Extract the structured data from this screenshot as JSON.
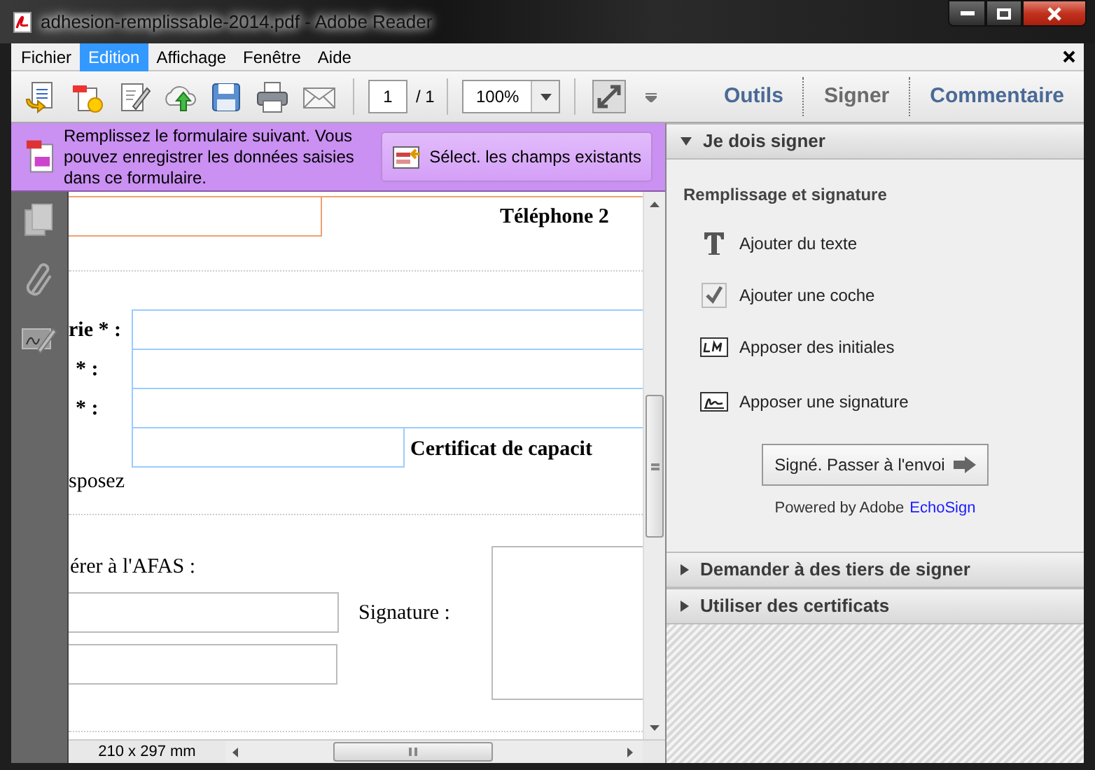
{
  "window": {
    "title": "adhesion-remplissable-2014.pdf - Adobe Reader"
  },
  "menu": [
    {
      "label": "Fichier",
      "selected": false
    },
    {
      "label": "Edition",
      "selected": true
    },
    {
      "label": "Affichage",
      "selected": false
    },
    {
      "label": "Fenêtre",
      "selected": false
    },
    {
      "label": "Aide",
      "selected": false
    }
  ],
  "toolbar": {
    "page": "1",
    "page_total": "/ 1",
    "zoom": "100%"
  },
  "panel_tabs": [
    {
      "label": "Outils",
      "selected": false
    },
    {
      "label": "Signer",
      "selected": true
    },
    {
      "label": "Commentaire",
      "selected": false
    }
  ],
  "form_bar": {
    "message": "Remplissez le formulaire suivant. Vous pouvez enregistrer les données saisies dans ce formulaire.",
    "button": "Sélect. les champs existants"
  },
  "document": {
    "labels": [
      {
        "text": "Téléphone 2",
        "bold": true
      },
      {
        "text": "rie * :",
        "bold": true
      },
      {
        "text": "* :",
        "bold": true
      },
      {
        "text": "* :",
        "bold": true
      },
      {
        "text": "Certificat de capacit",
        "bold": true
      },
      {
        "text": "sposez",
        "bold": false
      },
      {
        "text": "érer à l'AFAS :",
        "bold": false
      },
      {
        "text": "Signature :",
        "bold": false
      }
    ]
  },
  "status_bar": {
    "page_size": "210 x 297 mm"
  },
  "sign_panel": {
    "sections": [
      {
        "title": "Je dois signer",
        "expanded": true
      },
      {
        "title": "Demander à des tiers de signer",
        "expanded": false
      },
      {
        "title": "Utiliser des certificats",
        "expanded": false
      }
    ],
    "heading": "Remplissage et signature",
    "tools": [
      {
        "kind": "text",
        "label": "Ajouter du texte"
      },
      {
        "kind": "check",
        "label": "Ajouter une coche"
      },
      {
        "kind": "initials",
        "label": "Apposer des initiales"
      },
      {
        "kind": "signature",
        "label": "Apposer une signature"
      }
    ],
    "send_button": "Signé. Passer à l'envoi",
    "powered_by": "Powered by Adobe",
    "powered_link": "EchoSign"
  }
}
